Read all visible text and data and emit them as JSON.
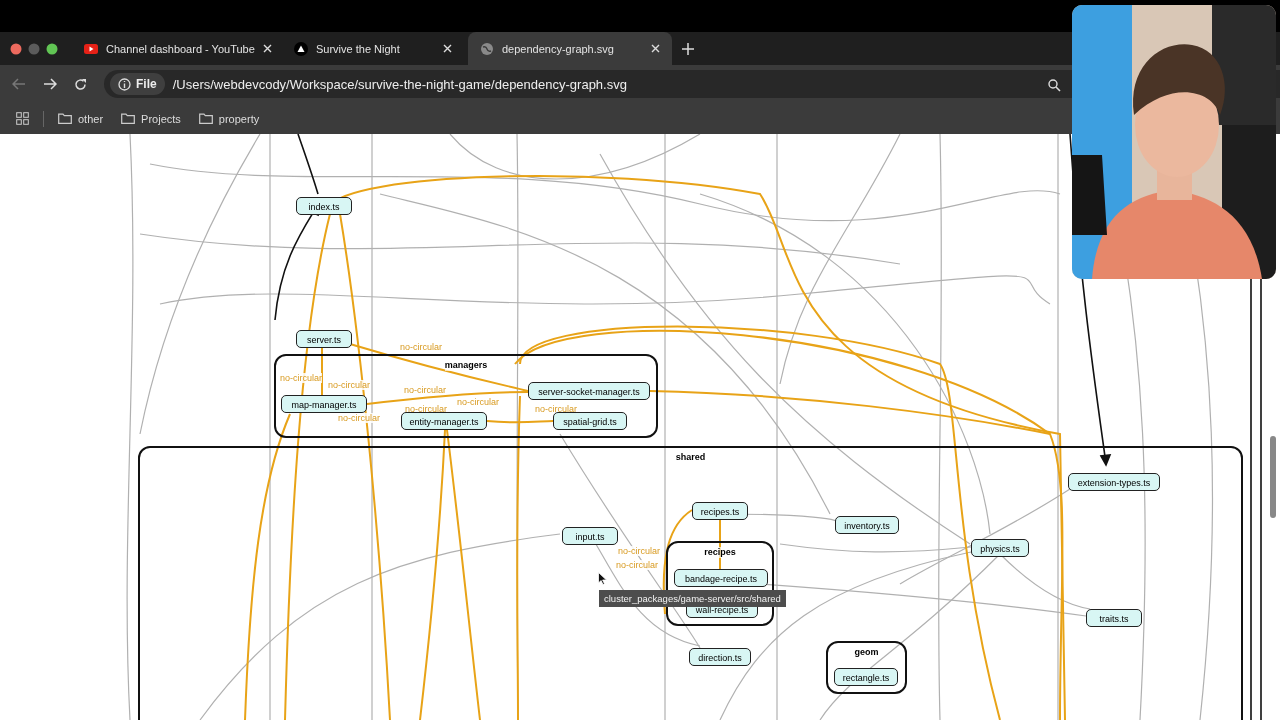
{
  "browser": {
    "tabs": [
      {
        "title": "Channel dashboard - YouTube",
        "selected": false
      },
      {
        "title": "Survive the Night",
        "selected": false
      },
      {
        "title": "dependency-graph.svg",
        "selected": true
      }
    ],
    "address": {
      "scheme": "File",
      "url": "/Users/webdevcody/Workspace/survive-the-night-game/dependency-graph.svg"
    },
    "bookmarks": [
      "other",
      "Projects",
      "property"
    ]
  },
  "graph": {
    "nodes": [
      "index.ts",
      "server.ts"
    ],
    "clusters": [
      {
        "label": "managers",
        "nodes": [
          "map-manager.ts",
          "entity-manager.ts",
          "server-socket-manager.ts",
          "spatial-grid.ts"
        ]
      },
      {
        "label": "shared",
        "nodes": [
          "recipes.ts",
          "input.ts",
          "inventory.ts",
          "physics.ts",
          "extension-types.ts",
          "traits.ts",
          "direction.ts"
        ],
        "clusters": [
          {
            "label": "recipes",
            "nodes": [
              "bandage-recipe.ts",
              "wall-recipe.ts"
            ]
          },
          {
            "label": "geom",
            "nodes": [
              "rectangle.ts"
            ]
          }
        ]
      }
    ],
    "edge_labels": [
      "no-circular",
      "no-circular",
      "no-circular",
      "no-circular",
      "no-circular",
      "no-circular",
      "no-circular",
      "no-circular",
      "no-circular",
      "no-circular"
    ],
    "tooltip": "cluster_packages/game-server/src/shared"
  }
}
